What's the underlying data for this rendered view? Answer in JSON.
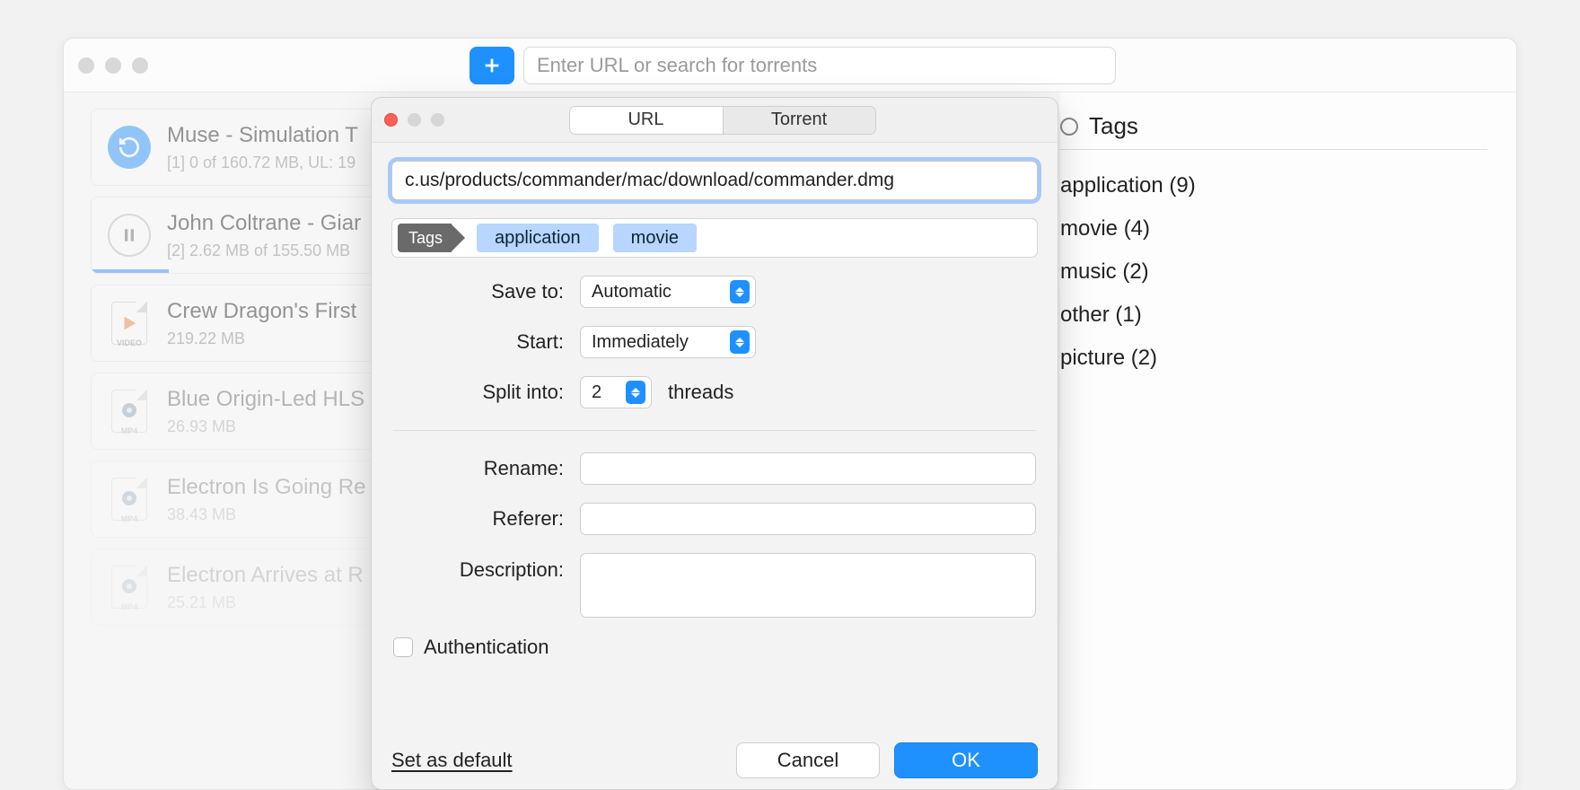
{
  "toolbar": {
    "search_placeholder": "Enter URL or search for torrents"
  },
  "downloads": [
    {
      "title": "Muse - Simulation T",
      "sub": "[1]  0 of 160.72 MB, UL: 19",
      "icon": "refresh",
      "progress_pct": 0
    },
    {
      "title": "John Coltrane - Giar",
      "sub": "[2]  2.62 MB of 155.50 MB",
      "icon": "pause",
      "progress_pct": 8
    },
    {
      "title": "Crew Dragon's First ",
      "sub": "219.22 MB",
      "icon": "video-file"
    },
    {
      "title": "Blue Origin-Led HLS",
      "sub": "26.93 MB",
      "icon": "mp4-file"
    },
    {
      "title": "Electron Is Going Re",
      "sub": "38.43 MB",
      "icon": "mp4-file"
    },
    {
      "title": "Electron Arrives at R",
      "sub": "25.21 MB",
      "icon": "mp4-file"
    }
  ],
  "sidebar": {
    "header": "Tags",
    "items": [
      {
        "label": "application (9)"
      },
      {
        "label": "movie (4)"
      },
      {
        "label": "music (2)"
      },
      {
        "label": "other (1)"
      },
      {
        "label": "picture (2)"
      }
    ]
  },
  "sheet": {
    "tabs": {
      "url": "URL",
      "torrent": "Torrent"
    },
    "url_value": "c.us/products/commander/mac/download/commander.dmg",
    "tags_label": "Tags",
    "tag_chips": [
      "application",
      "movie"
    ],
    "labels": {
      "save_to": "Save to:",
      "start": "Start:",
      "split": "Split into:",
      "threads": "threads",
      "rename": "Rename:",
      "referer": "Referer:",
      "description": "Description:",
      "auth": "Authentication",
      "default": "Set as default",
      "cancel": "Cancel",
      "ok": "OK"
    },
    "values": {
      "save_to": "Automatic",
      "start": "Immediately",
      "split": "2"
    }
  }
}
